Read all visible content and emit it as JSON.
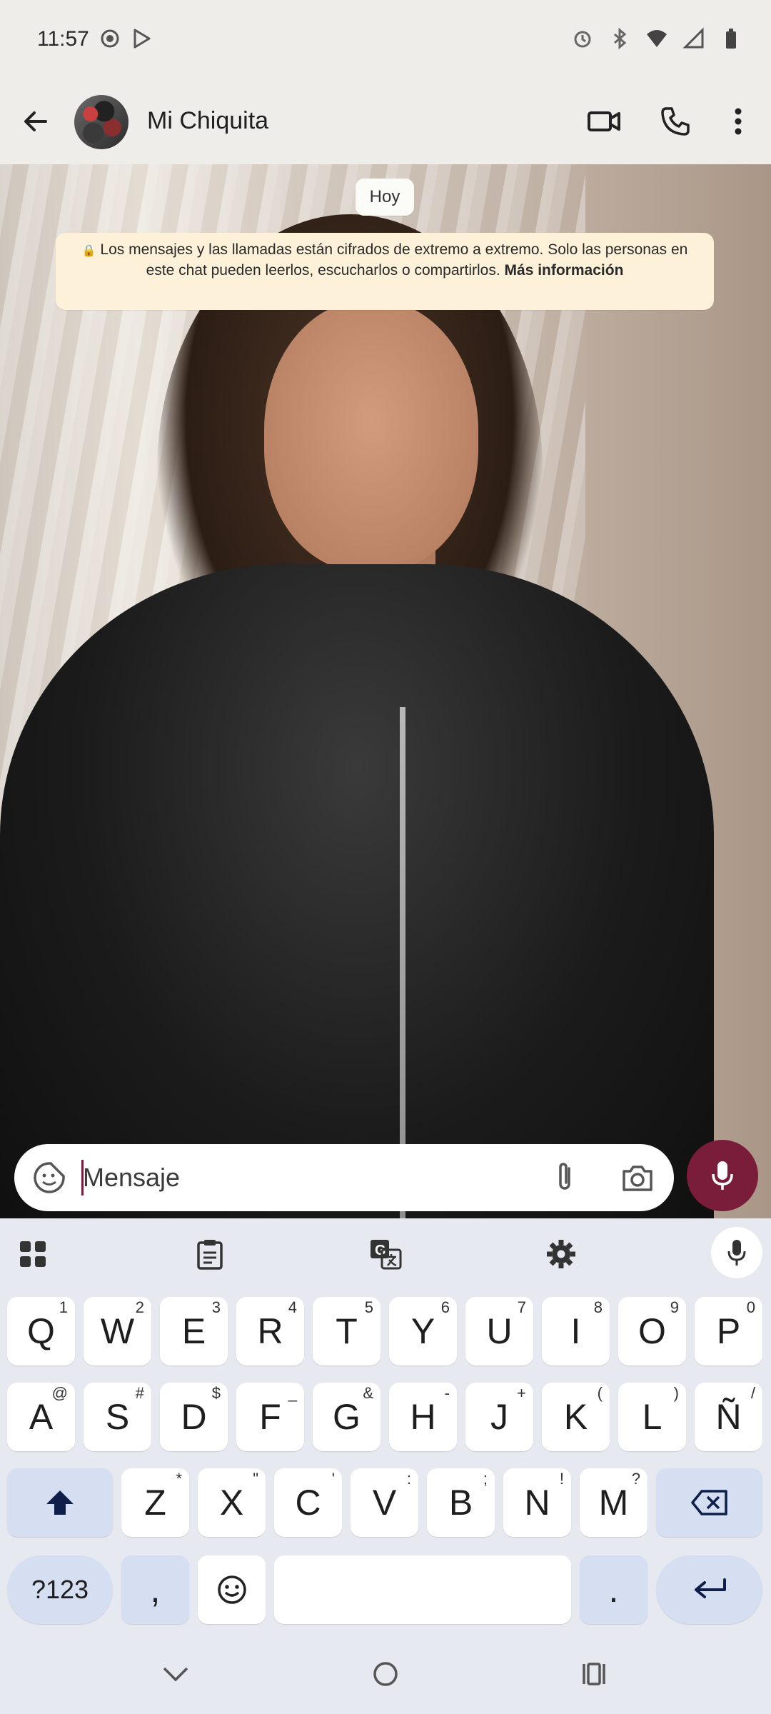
{
  "status_bar": {
    "time": "11:57",
    "left_icons": [
      "location-icon",
      "play-store-icon"
    ],
    "right_icons": [
      "alarm-icon",
      "bluetooth-icon",
      "wifi-icon",
      "signal-icon",
      "battery-icon"
    ]
  },
  "app_bar": {
    "contact_name": "Mi Chiquita",
    "actions": [
      "video-call-icon",
      "voice-call-icon",
      "more-options-icon"
    ]
  },
  "chat": {
    "date_chip": "Hoy",
    "encryption_notice": {
      "text": "Los mensajes y las llamadas están cifrados de extremo a extremo. Solo las personas en este chat pueden leerlos, escucharlos o compartirlos.",
      "link": "Más información"
    }
  },
  "composer": {
    "placeholder": "Mensaje",
    "accent_color": "#7a1d3a"
  },
  "keyboard": {
    "row1": [
      {
        "k": "Q",
        "s": "1"
      },
      {
        "k": "W",
        "s": "2"
      },
      {
        "k": "E",
        "s": "3"
      },
      {
        "k": "R",
        "s": "4"
      },
      {
        "k": "T",
        "s": "5"
      },
      {
        "k": "Y",
        "s": "6"
      },
      {
        "k": "U",
        "s": "7"
      },
      {
        "k": "I",
        "s": "8"
      },
      {
        "k": "O",
        "s": "9"
      },
      {
        "k": "P",
        "s": "0"
      }
    ],
    "row2": [
      {
        "k": "A",
        "s": "@"
      },
      {
        "k": "S",
        "s": "#"
      },
      {
        "k": "D",
        "s": "$"
      },
      {
        "k": "F",
        "s": "_"
      },
      {
        "k": "G",
        "s": "&"
      },
      {
        "k": "H",
        "s": "-"
      },
      {
        "k": "J",
        "s": "+"
      },
      {
        "k": "K",
        "s": "("
      },
      {
        "k": "L",
        "s": ")"
      },
      {
        "k": "Ñ",
        "s": "/"
      }
    ],
    "row3": [
      {
        "k": "Z",
        "s": "*"
      },
      {
        "k": "X",
        "s": "\""
      },
      {
        "k": "C",
        "s": "'"
      },
      {
        "k": "V",
        "s": ":"
      },
      {
        "k": "B",
        "s": ";"
      },
      {
        "k": "N",
        "s": "!"
      },
      {
        "k": "M",
        "s": "?"
      }
    ],
    "symbols_key": "?123",
    "comma_key": ",",
    "period_key": "."
  }
}
